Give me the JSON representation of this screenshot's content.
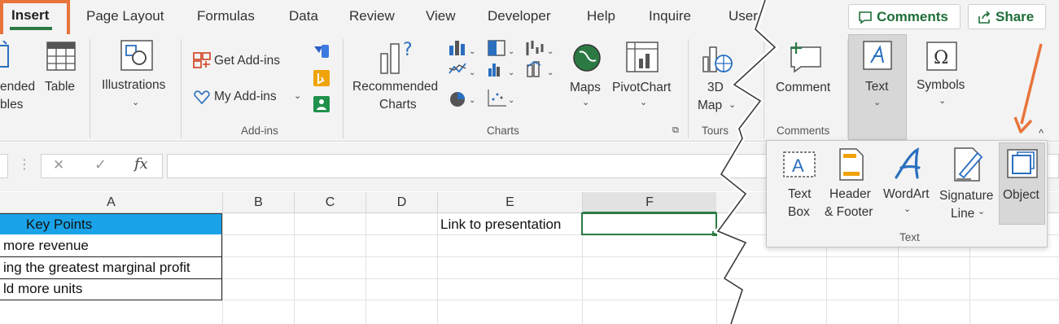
{
  "ribbon_tabs": {
    "insert": "Insert",
    "page_layout": "Page Layout",
    "formulas": "Formulas",
    "data": "Data",
    "review": "Review",
    "view": "View",
    "developer": "Developer",
    "help": "Help",
    "inquire": "Inquire",
    "user": "User"
  },
  "header_buttons": {
    "comments": "Comments",
    "share": "Share"
  },
  "ribbon": {
    "tables": {
      "recommended_l1": "ended",
      "recommended_l2": "bles",
      "table": "Table"
    },
    "illustrations": "Illustrations",
    "addins": {
      "get": "Get Add-ins",
      "my": "My Add-ins",
      "group": "Add-ins"
    },
    "charts": {
      "recommended_l1": "Recommended",
      "recommended_l2": "Charts",
      "maps": "Maps",
      "pivotchart": "PivotChart",
      "group": "Charts"
    },
    "tours": {
      "map_l1": "3D",
      "map_l2": "Map",
      "group": "Tours"
    },
    "comments": {
      "comment": "Comment",
      "group": "Comments"
    },
    "text": "Text",
    "symbols": "Symbols"
  },
  "formula_bar": {
    "fx": "fx",
    "cancel": "✕",
    "enter": "✓",
    "dots": "⋮",
    "value": ""
  },
  "columns": [
    "A",
    "B",
    "C",
    "D",
    "E",
    "F"
  ],
  "cells": {
    "a1": "Key Points",
    "a2": "more revenue",
    "a3": "ing the greatest marginal profit",
    "a4": "ld more units",
    "e1": "Link to presentation"
  },
  "text_menu": {
    "textbox_l1": "Text",
    "textbox_l2": "Box",
    "header_l1": "Header",
    "header_l2": "& Footer",
    "wordart": "WordArt",
    "signature_l1": "Signature",
    "signature_l2": "Line",
    "object": "Object",
    "group": "Text"
  },
  "colors": {
    "highlight": "#e8743b",
    "excel_green": "#2b7a43",
    "header_cell": "#1aa3e8",
    "selected_column": "#e2e2e2"
  },
  "icons": [
    "table-icon",
    "illustrations-icon",
    "store-icon",
    "addins-icon",
    "chart-icon",
    "maps-globe-icon",
    "pivotchart-icon",
    "3d-map-icon",
    "comment-icon",
    "text-icon",
    "omega-icon",
    "textbox-icon",
    "header-footer-icon",
    "wordart-icon",
    "signature-icon",
    "object-icon",
    "arrow-annotation-icon"
  ]
}
